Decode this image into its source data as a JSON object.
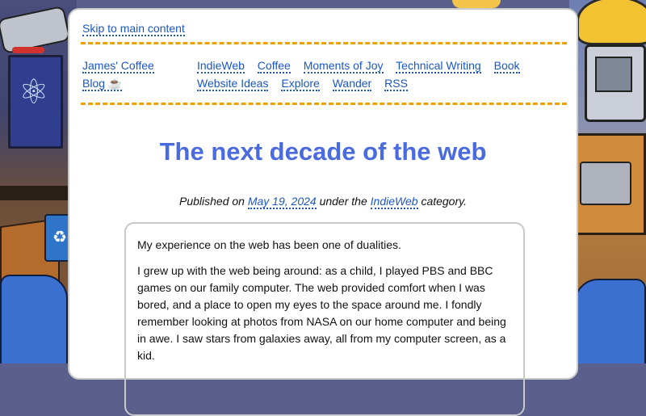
{
  "skip_link": "Skip to main content",
  "site_name": "James' Coffee Blog ☕",
  "nav": {
    "items": [
      "IndieWeb",
      "Coffee",
      "Moments of Joy",
      "Technical Writing",
      "Book",
      "Website Ideas",
      "Explore",
      "Wander",
      "RSS"
    ]
  },
  "post": {
    "title": "The next decade of the web",
    "published_prefix": "Published on",
    "date": "May 19, 2024",
    "category_prefix": "under the",
    "category": "IndieWeb",
    "category_suffix": "category.",
    "paragraphs": [
      "My experience on the web has been one of dualities.",
      "I grew up with the web being around: as a child, I played PBS and BBC games on our family computer. The web provided comfort when I was bored, and a place to open my eyes to the space around me. I fondly remember looking at photos from NASA on our home computer and being in awe. I saw stars from galaxies away, all from my computer screen, as a kid."
    ]
  },
  "colors": {
    "link": "#1b56c4",
    "title": "#4a6ae0",
    "divider": "#f0a000"
  },
  "icons": [
    "atom-icon",
    "recycle-icon"
  ]
}
